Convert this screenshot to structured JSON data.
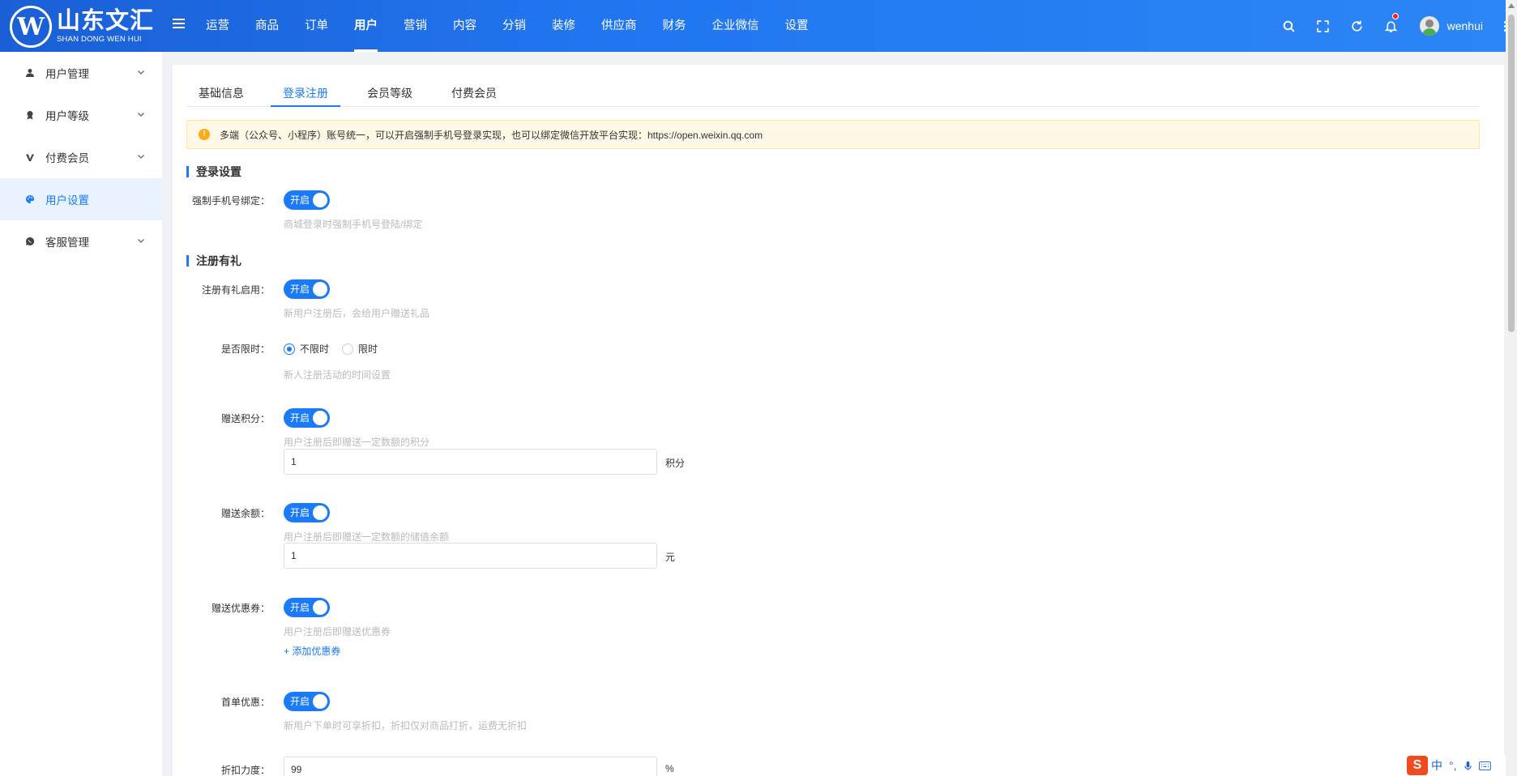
{
  "brand": {
    "name_cn": "山东文汇",
    "name_en": "SHAN DONG WEN HUI",
    "mark": "W"
  },
  "header": {
    "nav": [
      {
        "label": "运营"
      },
      {
        "label": "商品"
      },
      {
        "label": "订单"
      },
      {
        "label": "用户"
      },
      {
        "label": "营销"
      },
      {
        "label": "内容"
      },
      {
        "label": "分销"
      },
      {
        "label": "装修"
      },
      {
        "label": "供应商"
      },
      {
        "label": "财务"
      },
      {
        "label": "企业微信"
      },
      {
        "label": "设置"
      }
    ],
    "active_nav": "用户",
    "username": "wenhui",
    "tools": [
      "search-icon",
      "fullscreen-icon",
      "refresh-icon",
      "bell-icon"
    ]
  },
  "sidebar": {
    "items": [
      {
        "label": "用户管理",
        "icon": "user-icon"
      },
      {
        "label": "用户等级",
        "icon": "level-icon"
      },
      {
        "label": "付费会员",
        "icon": "vip-icon"
      },
      {
        "label": "用户设置",
        "icon": "palette-icon"
      },
      {
        "label": "客服管理",
        "icon": "chat-icon"
      }
    ],
    "active": "用户设置"
  },
  "tabs": [
    {
      "label": "基础信息"
    },
    {
      "label": "登录注册"
    },
    {
      "label": "会员等级"
    },
    {
      "label": "付费会员"
    }
  ],
  "active_tab": "登录注册",
  "alert": {
    "text": "多端（公众号、小程序）账号统一，可以开启强制手机号登录实现，也可以绑定微信开放平台实现：https://open.weixin.qq.com"
  },
  "login_section": {
    "title": "登录设置",
    "force_phone": {
      "label": "强制手机号绑定：",
      "switch": "开启",
      "help": "商城登录时强制手机号登陆/绑定"
    }
  },
  "register_section": {
    "title": "注册有礼",
    "enable": {
      "label": "注册有礼启用：",
      "switch": "开启",
      "help": "新用户注册后，会给用户赠送礼品"
    },
    "time_limit": {
      "label": "是否限时：",
      "options": [
        "不限时",
        "限时"
      ],
      "selected": "不限时",
      "help": "新人注册活动的时间设置"
    },
    "points": {
      "label": "赠送积分：",
      "switch": "开启",
      "help": "用户注册后即赠送一定数额的积分",
      "value": "1",
      "unit": "积分"
    },
    "balance": {
      "label": "赠送余额：",
      "switch": "开启",
      "help": "用户注册后即赠送一定数额的储值余额",
      "value": "1",
      "unit": "元"
    },
    "coupon": {
      "label": "赠送优惠券：",
      "switch": "开启",
      "help": "用户注册后即赠送优惠券",
      "link": "+ 添加优惠券"
    },
    "first_order": {
      "label": "首单优惠：",
      "switch": "开启",
      "help": "新用户下单时可享折扣，折扣仅对商品打折，运费无折扣"
    },
    "discount": {
      "label": "折扣力度：",
      "value": "99",
      "unit": "%"
    }
  },
  "ime": {
    "logo": "S",
    "labels": [
      "中",
      "°,"
    ]
  }
}
